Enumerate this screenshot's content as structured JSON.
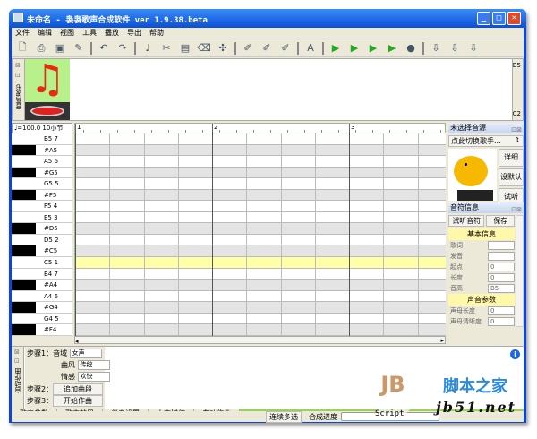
{
  "window": {
    "title": "未命名 - 袅袅歌声合成软件 ver 1.9.38.beta",
    "minimize": "_",
    "maximize": "□",
    "close": "✕"
  },
  "menu": [
    "文件",
    "编辑",
    "视图",
    "工具",
    "播放",
    "导出",
    "帮助"
  ],
  "toolbar_icons": [
    "new-icon",
    "print-icon",
    "save-icon",
    "save-as-icon",
    "undo-icon",
    "redo-icon",
    "note-icon",
    "cut-icon",
    "paste-icon",
    "eraser-icon",
    "grid-icon",
    "brush-icon",
    "brush2-icon",
    "brush3-icon",
    "text-icon",
    "play-from-icon",
    "play-sel-icon",
    "play-all-icon",
    "play-icon",
    "stop-icon",
    "export-icon",
    "export2-icon",
    "export3-icon"
  ],
  "wave": {
    "side_label": "音高波形",
    "top_note": "B5",
    "bottom_note": "C2"
  },
  "tempo": "♩=100.0 10小节",
  "ruler": [
    "1",
    "2",
    "3"
  ],
  "keys": [
    {
      "n": "B5",
      "d": "7",
      "black": false
    },
    {
      "n": "#A5",
      "d": "",
      "black": true
    },
    {
      "n": "A5",
      "d": "6",
      "black": false
    },
    {
      "n": "#G5",
      "d": "",
      "black": true
    },
    {
      "n": "G5",
      "d": "5",
      "black": false
    },
    {
      "n": "#F5",
      "d": "",
      "black": true
    },
    {
      "n": "F5",
      "d": "4",
      "black": false
    },
    {
      "n": "E5",
      "d": "3",
      "black": false
    },
    {
      "n": "#D5",
      "d": "",
      "black": true
    },
    {
      "n": "D5",
      "d": "2",
      "black": false
    },
    {
      "n": "#C5",
      "d": "",
      "black": true
    },
    {
      "n": "C5",
      "d": "1",
      "black": false
    },
    {
      "n": "B4",
      "d": "7",
      "black": false
    },
    {
      "n": "#A4",
      "d": "",
      "black": true
    },
    {
      "n": "A4",
      "d": "6",
      "black": false
    },
    {
      "n": "#G4",
      "d": "",
      "black": true
    },
    {
      "n": "G4",
      "d": "5",
      "black": false
    },
    {
      "n": "#F4",
      "d": "",
      "black": true
    }
  ],
  "singer": {
    "title": "未选择音源",
    "select": "点此切换歌手...",
    "detail": "详细",
    "default": "设默认",
    "listen": "试听"
  },
  "note_info": {
    "title": "音符信息",
    "listen": "试听音符",
    "save": "保存",
    "basic": "基本信息",
    "lyric": "歌词",
    "pron": "发音",
    "start": "起点",
    "start_val": "0",
    "length": "长度",
    "length_val": "0",
    "pitch": "音高",
    "pitch_val": "B5",
    "voice": "声音参数",
    "init_len": "声母长度",
    "init_len_val": "0",
    "init_clear": "声母清晰度",
    "init_clear_val": "0"
  },
  "auto": {
    "side": "自动作曲",
    "step1": "步骤1：",
    "range": "音域",
    "range_val": "女声",
    "style": "曲风",
    "style_val": "传统",
    "emotion": "情感",
    "emotion_val": "欢快",
    "step2": "步骤2：",
    "add": "追加曲段",
    "step3": "步骤3：",
    "start": "开始作曲"
  },
  "tabs": [
    "歌声参数",
    "歌声效果",
    "伴奏设置",
    "人声模仿",
    "自动作曲"
  ],
  "status": {
    "multi": "连续多选",
    "progress": "合成进度",
    "watermark": "Script",
    "site": "jb51.net",
    "site_cn": "脚本之家"
  }
}
